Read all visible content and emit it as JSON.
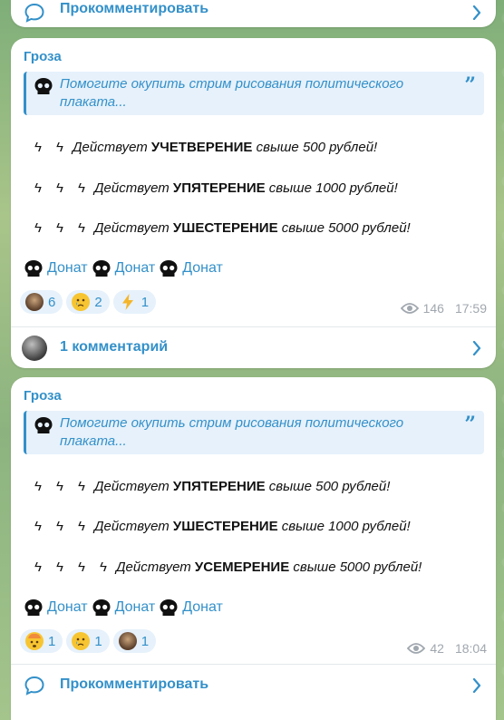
{
  "top_comment": {
    "label": "Прокомментировать"
  },
  "posts": [
    {
      "author": "Гроза",
      "quote": "Помогите окупить стрим рисования политического плаката...",
      "lines": [
        {
          "bolts": 2,
          "pre": "Действует",
          "tier": "УЧЕТВЕРЕНИЕ",
          "post": "свыше 500 рублей!"
        },
        {
          "bolts": 3,
          "pre": "Действует",
          "tier": "УПЯТЕРЕНИЕ",
          "post": "свыше 1000 рублей!"
        },
        {
          "bolts": 3,
          "pre": "Действует",
          "tier": "УШЕСТЕРЕНИЕ",
          "post": "свыше 5000 рублей!"
        }
      ],
      "donate_label": "Донат",
      "reactions": [
        {
          "icon": "character-sticker-icon",
          "count": "6"
        },
        {
          "icon": "crying-face-icon",
          "count": "2"
        },
        {
          "icon": "lightning-icon",
          "count": "1"
        }
      ],
      "views": "146",
      "time": "17:59",
      "comment_label": "1 комментарий"
    },
    {
      "author": "Гроза",
      "quote": "Помогите окупить стрим рисования политического плаката...",
      "lines": [
        {
          "bolts": 3,
          "pre": "Действует",
          "tier": "УПЯТЕРЕНИЕ",
          "post": "свыше 500 рублей!"
        },
        {
          "bolts": 3,
          "pre": "Действует",
          "tier": "УШЕСТЕРЕНИЕ",
          "post": "свыше 1000 рублей!"
        },
        {
          "bolts": 4,
          "pre": "Действует",
          "tier": "УСЕМЕРЕНИЕ",
          "post": "свыше 5000 рублей!"
        }
      ],
      "donate_label": "Донат",
      "reactions": [
        {
          "icon": "exploding-head-icon",
          "count": "1"
        },
        {
          "icon": "crying-face-icon",
          "count": "1"
        },
        {
          "icon": "character-sticker-icon",
          "count": "1"
        }
      ],
      "views": "42",
      "time": "18:04",
      "comment_label": "Прокомментировать"
    }
  ],
  "colors": {
    "accent": "#3390c9",
    "quote_bg": "#e6f1fb",
    "meta": "#a0a7ae"
  }
}
